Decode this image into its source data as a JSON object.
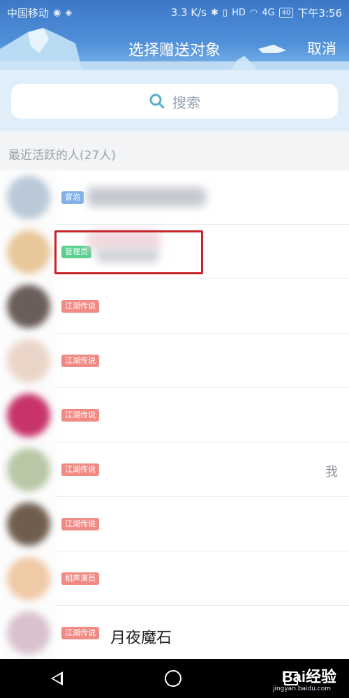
{
  "status_bar": {
    "carrier": "中国移动",
    "speed": "3.3 K/s",
    "signal_label": "4G",
    "battery": "40",
    "time": "下午3:56"
  },
  "header": {
    "title": "选择赠送对象",
    "cancel_label": "取消"
  },
  "search": {
    "placeholder": "搜索"
  },
  "section": {
    "title": "最近活跃的人(27人)"
  },
  "members": [
    {
      "badge": "冒泡",
      "badge_color": "#7fb0e8",
      "avatar_color": "#b9c9d8"
    },
    {
      "badge": "管理员",
      "badge_color": "#5ccf8f",
      "avatar_color": "#e8c79a"
    },
    {
      "badge": "江湖传说",
      "badge_color": "#f08a84",
      "avatar_color": "#6a5d5a"
    },
    {
      "badge": "江湖传说",
      "badge_color": "#f08a84",
      "avatar_color": "#ebd5c9"
    },
    {
      "badge": "江湖传说",
      "badge_color": "#f08a84",
      "avatar_color": "#c7336a"
    },
    {
      "badge": "江湖传说",
      "badge_color": "#f08a84",
      "avatar_color": "#b8c7a5",
      "me": "我"
    },
    {
      "badge": "江湖传说",
      "badge_color": "#f08a84",
      "avatar_color": "#6f5e4d"
    },
    {
      "badge": "相声演员",
      "badge_color": "#f08a84",
      "avatar_color": "#f0c9a5"
    },
    {
      "badge": "江湖传说",
      "badge_color": "#f08a84",
      "avatar_color": "#d9c2cf",
      "name": "月夜魔石"
    }
  ],
  "watermark": {
    "brand": "Bai经验",
    "url": "jingyan.baidu.com"
  },
  "colors": {
    "header_blue": "#3b78c8",
    "search_bg": "#dfeef9",
    "highlight_red": "#c5252b"
  }
}
